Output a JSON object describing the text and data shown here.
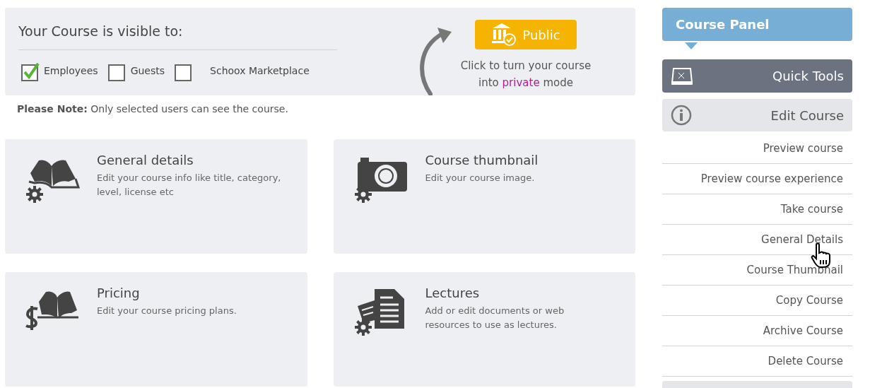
{
  "visibility": {
    "title": "Your Course is visible to:",
    "options": [
      {
        "label": "Employees",
        "checked": true
      },
      {
        "label": "Guests",
        "checked": false
      },
      {
        "label": "Schoox Marketplace",
        "checked": false
      }
    ],
    "public_button": "Public",
    "hint": {
      "before": "Click to turn your course into",
      "link": "private",
      "after": "mode"
    }
  },
  "note": "**Please Note:** Only selected users can see the course.",
  "cards": [
    {
      "title": "General details",
      "description": "Edit your course info like title, category, level, license etc"
    },
    {
      "title": "Course thumbnail",
      "description": "Edit your course image."
    },
    {
      "title": "Pricing",
      "description": "Edit your course pricing plans."
    },
    {
      "title": "Lectures",
      "description": "Add or edit documents or web resources to use as lectures."
    }
  ],
  "sidebar": {
    "header": "Course Panel",
    "quick_tools": "Quick Tools",
    "edit_course": "Edit Course",
    "items": [
      "Preview course",
      "Preview course experience",
      "Take course",
      "General Details",
      "Course Thumbnail",
      "Copy Course",
      "Archive Course",
      "Delete Course"
    ]
  }
}
